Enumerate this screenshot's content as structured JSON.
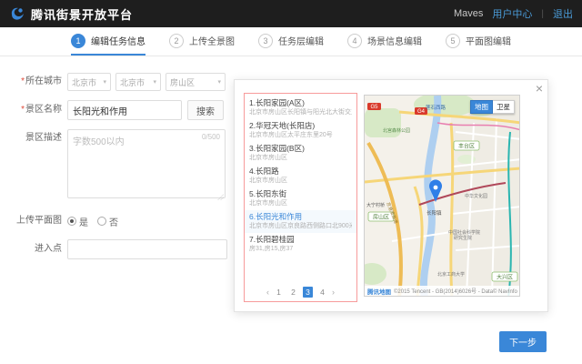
{
  "header": {
    "logo_title": "腾讯街景开放平台",
    "username": "Maves",
    "user_center": "用户中心",
    "logout": "退出",
    "separator": "|"
  },
  "steps": [
    {
      "num": "1",
      "label": "编辑任务信息"
    },
    {
      "num": "2",
      "label": "上传全景图"
    },
    {
      "num": "3",
      "label": "任务层编辑"
    },
    {
      "num": "4",
      "label": "场景信息编辑"
    },
    {
      "num": "5",
      "label": "平面图编辑"
    }
  ],
  "form": {
    "required_mark": "*",
    "city_label": "所在城市",
    "city_selects": [
      "北京市",
      "北京市",
      "房山区"
    ],
    "chevron": "▾",
    "name_label": "景区名称",
    "name_value": "长阳光和作用",
    "search_button": "搜索",
    "desc_label": "景区描述",
    "desc_placeholder": "字数500以内",
    "desc_counter": "0/500",
    "upload_label": "上传平面图",
    "radio_yes": "是",
    "radio_no": "否",
    "entry_label": "进入点"
  },
  "panel": {
    "close": "×",
    "results": [
      {
        "title": "1.长阳家园(A区)",
        "subtitle": "北京市房山区长阳镇与阳光北大街交叉"
      },
      {
        "title": "2.华冠天地(长阳店)",
        "subtitle": "北京市房山区太平庄东里20号"
      },
      {
        "title": "3.长阳家园(B区)",
        "subtitle": "北京市房山区"
      },
      {
        "title": "4.长阳路",
        "subtitle": "北京市房山区"
      },
      {
        "title": "5.长阳东街",
        "subtitle": "北京市房山区"
      },
      {
        "title": "6.长阳光和作用",
        "subtitle": "北京市房山区京良路西侧路口北900米"
      },
      {
        "title": "7.长阳碧桂园",
        "subtitle": "房31,房15,房37"
      }
    ],
    "pagination": {
      "prev": "‹",
      "pages": [
        "1",
        "2",
        "3",
        "4"
      ],
      "active_page": "3",
      "next": "›"
    }
  },
  "map": {
    "toggle_map": "地图",
    "toggle_satellite": "卫星",
    "labels": {
      "road_top": "莲石西路",
      "park": "北宫森林公园",
      "district_fengtai": "丰台区",
      "district_fangshan": "房山区",
      "district_daxing": "大兴区",
      "town": "长阳镇",
      "culture_park": "中华文化园",
      "academy_line1": "中国社会科学院",
      "academy_line2": "研究生院",
      "university": "北京工商大学",
      "bridge": "大宁村桥",
      "expressway": "京港澳高速",
      "shield_a": "G4",
      "shield_b": "G5"
    },
    "attribution": {
      "brand": "腾讯地图",
      "text": "©2015 Tencent - GB(2014)6026号 - Data© NavInfo"
    }
  },
  "footer": {
    "next_button": "下一步"
  },
  "colors": {
    "accent": "#3a87d8",
    "list_border": "#f79b9b",
    "header_bg": "#1e1e1e"
  }
}
